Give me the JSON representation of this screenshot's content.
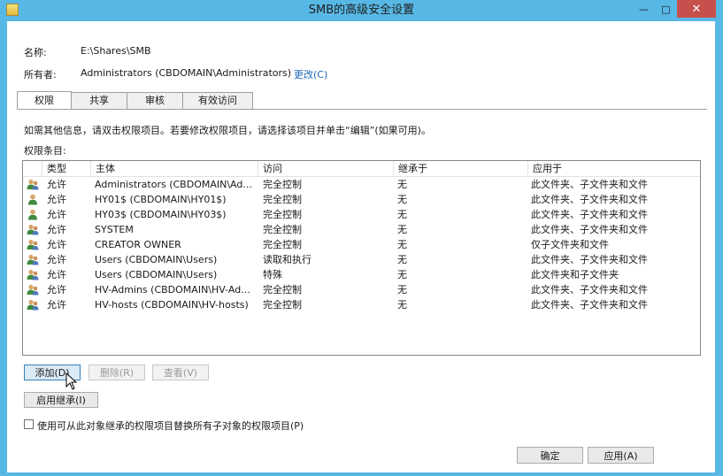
{
  "window": {
    "title": "SMB的高级安全设置",
    "controls": {
      "minimize": "—",
      "maximize": "□",
      "close": "✕"
    }
  },
  "info": {
    "name_label": "名称:",
    "name_value": "E:\\Shares\\SMB",
    "owner_label": "所有者:",
    "owner_value": "Administrators (CBDOMAIN\\Administrators)",
    "change_link": "更改(C)"
  },
  "tabs": [
    {
      "label": "权限",
      "active": true
    },
    {
      "label": "共享",
      "active": false
    },
    {
      "label": "审核",
      "active": false
    },
    {
      "label": "有效访问",
      "active": false
    }
  ],
  "hint": "如需其他信息，请双击权限项目。若要修改权限项目，请选择该项目并单击“编辑”(如果可用)。",
  "entries_label": "权限条目:",
  "table": {
    "columns": [
      "类型",
      "主体",
      "访问",
      "继承于",
      "应用于"
    ],
    "rows": [
      {
        "icon": "group",
        "type": "允许",
        "principal": "Administrators (CBDOMAIN\\Ad...",
        "access": "完全控制",
        "inherited": "无",
        "applies": "此文件夹、子文件夹和文件"
      },
      {
        "icon": "user",
        "type": "允许",
        "principal": "HY01$ (CBDOMAIN\\HY01$)",
        "access": "完全控制",
        "inherited": "无",
        "applies": "此文件夹、子文件夹和文件"
      },
      {
        "icon": "user",
        "type": "允许",
        "principal": "HY03$ (CBDOMAIN\\HY03$)",
        "access": "完全控制",
        "inherited": "无",
        "applies": "此文件夹、子文件夹和文件"
      },
      {
        "icon": "group",
        "type": "允许",
        "principal": "SYSTEM",
        "access": "完全控制",
        "inherited": "无",
        "applies": "此文件夹、子文件夹和文件"
      },
      {
        "icon": "group",
        "type": "允许",
        "principal": "CREATOR OWNER",
        "access": "完全控制",
        "inherited": "无",
        "applies": "仅子文件夹和文件"
      },
      {
        "icon": "group",
        "type": "允许",
        "principal": "Users (CBDOMAIN\\Users)",
        "access": "读取和执行",
        "inherited": "无",
        "applies": "此文件夹、子文件夹和文件"
      },
      {
        "icon": "group",
        "type": "允许",
        "principal": "Users (CBDOMAIN\\Users)",
        "access": "特殊",
        "inherited": "无",
        "applies": "此文件夹和子文件夹"
      },
      {
        "icon": "group",
        "type": "允许",
        "principal": "HV-Admins (CBDOMAIN\\HV-Ad...",
        "access": "完全控制",
        "inherited": "无",
        "applies": "此文件夹、子文件夹和文件"
      },
      {
        "icon": "group",
        "type": "允许",
        "principal": "HV-hosts (CBDOMAIN\\HV-hosts)",
        "access": "完全控制",
        "inherited": "无",
        "applies": "此文件夹、子文件夹和文件"
      }
    ]
  },
  "buttons": {
    "add": "添加(D)",
    "remove": "删除(R)",
    "view": "查看(V)",
    "enable_inheritance": "启用继承(I)",
    "ok": "确定",
    "apply": "应用(A)"
  },
  "replace_checkbox": "使用可从此对象继承的权限项目替换所有子对象的权限项目(P)",
  "colors": {
    "titlebar": "#58b8e5",
    "link": "#1a67b8",
    "close": "#c7504c"
  }
}
